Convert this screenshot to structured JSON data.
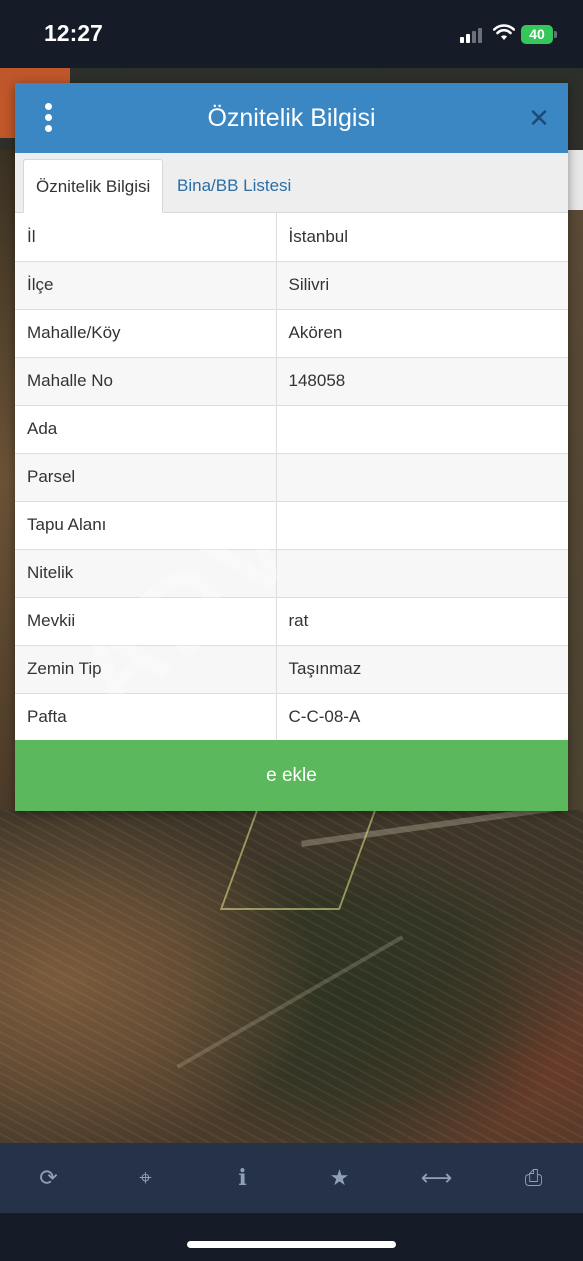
{
  "status_bar": {
    "time": "12:27",
    "battery": "40"
  },
  "dialog": {
    "title": "Öznitelik Bilgisi",
    "menu_icon": "kebab-icon",
    "close_icon": "close-icon",
    "tabs": [
      {
        "label": "Öznitelik Bilgisi",
        "active": true
      },
      {
        "label": "Bina/BB Listesi",
        "active": false
      }
    ],
    "rows": [
      {
        "key": "İl",
        "value": "İstanbul"
      },
      {
        "key": "İlçe",
        "value": "Silivri"
      },
      {
        "key": "Mahalle/Köy",
        "value": "Akören"
      },
      {
        "key": "Mahalle No",
        "value": "148058"
      },
      {
        "key": "Ada",
        "value": ""
      },
      {
        "key": "Parsel",
        "value": ""
      },
      {
        "key": "Tapu Alanı",
        "value": ""
      },
      {
        "key": "Nitelik",
        "value": ""
      },
      {
        "key": "Mevkii",
        "value": "rat"
      },
      {
        "key": "Zemin Tip",
        "value": "Taşınmaz"
      },
      {
        "key": "Pafta",
        "value": "C-C-08-A"
      }
    ],
    "add_button_label": "e ekle"
  },
  "watermark": "ADV",
  "toolbar": {
    "items": [
      {
        "icon": "refresh-icon",
        "glyph": "⟳"
      },
      {
        "icon": "locate-icon",
        "glyph": "⌖"
      },
      {
        "icon": "info-icon",
        "glyph": "i"
      },
      {
        "icon": "star-icon",
        "glyph": "★"
      },
      {
        "icon": "measure-icon",
        "glyph": "⟷"
      },
      {
        "icon": "print-icon",
        "glyph": "⎙"
      }
    ]
  },
  "colors": {
    "header": "#3a87c4",
    "button": "#5cb85c",
    "toolbar": "#253247",
    "tab_link": "#2a6ea6"
  }
}
